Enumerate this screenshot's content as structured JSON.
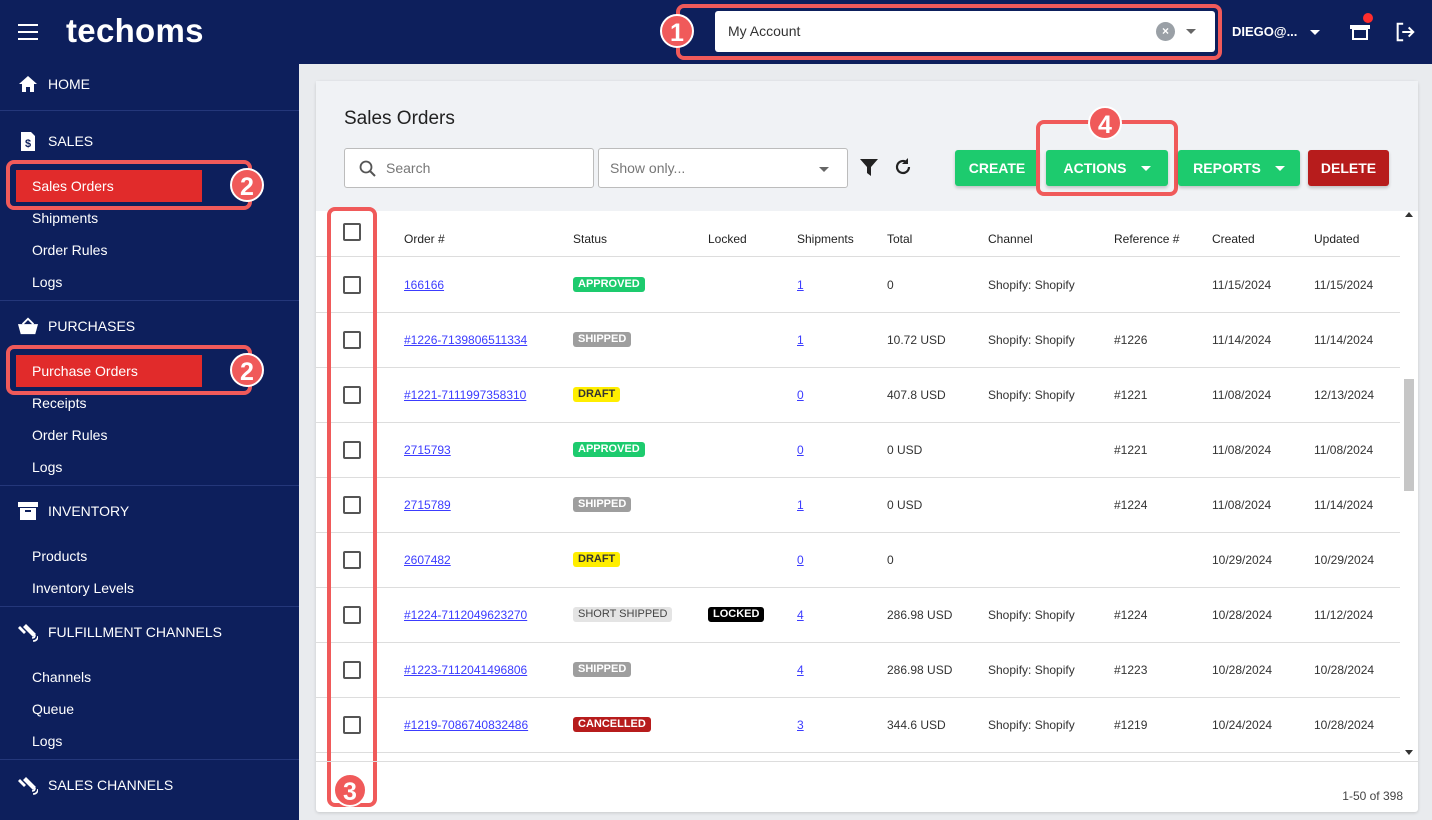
{
  "header": {
    "logo": "techoms",
    "account_value": "My Account",
    "user": "DIEGO@..."
  },
  "callouts": [
    "1",
    "2",
    "2",
    "3",
    "4"
  ],
  "sidebar": {
    "home": "HOME",
    "sales": {
      "title": "SALES",
      "items": [
        "Sales Orders",
        "Shipments",
        "Order Rules",
        "Logs"
      ]
    },
    "purchases": {
      "title": "PURCHASES",
      "items": [
        "Purchase Orders",
        "Receipts",
        "Order Rules",
        "Logs"
      ]
    },
    "inventory": {
      "title": "INVENTORY",
      "items": [
        "Products",
        "Inventory Levels"
      ]
    },
    "fulfillment": {
      "title": "FULFILLMENT CHANNELS",
      "items": [
        "Channels",
        "Queue",
        "Logs"
      ]
    },
    "sales_channels": {
      "title": "SALES CHANNELS"
    }
  },
  "main": {
    "title": "Sales Orders",
    "search_placeholder": "Search",
    "show_only_placeholder": "Show only...",
    "buttons": {
      "create": "CREATE",
      "actions": "ACTIONS",
      "reports": "REPORTS",
      "delete": "DELETE"
    },
    "colors": {
      "green": "#1dcb6e",
      "red": "#b71c1c"
    },
    "columns": [
      "Order #",
      "Status",
      "Locked",
      "Shipments",
      "Total",
      "Channel",
      "Reference #",
      "Created",
      "Updated"
    ],
    "rows": [
      {
        "order": "166166",
        "status": "APPROVED",
        "locked": "",
        "shipments": "1",
        "total": "0",
        "channel": "Shopify: Shopify",
        "reference": "",
        "created": "11/15/2024",
        "updated": "11/15/2024"
      },
      {
        "order": "#1226-7139806511334",
        "status": "SHIPPED",
        "locked": "",
        "shipments": "1",
        "total": "10.72 USD",
        "channel": "Shopify: Shopify",
        "reference": "#1226",
        "created": "11/14/2024",
        "updated": "11/14/2024"
      },
      {
        "order": "#1221-7111997358310",
        "status": "DRAFT",
        "locked": "",
        "shipments": "0",
        "total": "407.8 USD",
        "channel": "Shopify: Shopify",
        "reference": "#1221",
        "created": "11/08/2024",
        "updated": "12/13/2024"
      },
      {
        "order": "2715793",
        "status": "APPROVED",
        "locked": "",
        "shipments": "0",
        "total": "0 USD",
        "channel": "",
        "reference": "#1221",
        "created": "11/08/2024",
        "updated": "11/08/2024"
      },
      {
        "order": "2715789",
        "status": "SHIPPED",
        "locked": "",
        "shipments": "1",
        "total": "0 USD",
        "channel": "",
        "reference": "#1224",
        "created": "11/08/2024",
        "updated": "11/14/2024"
      },
      {
        "order": "2607482",
        "status": "DRAFT",
        "locked": "",
        "shipments": "0",
        "total": "0",
        "channel": "",
        "reference": "",
        "created": "10/29/2024",
        "updated": "10/29/2024"
      },
      {
        "order": "#1224-7112049623270",
        "status": "SHORT SHIPPED",
        "locked": "LOCKED",
        "shipments": "4",
        "total": "286.98 USD",
        "channel": "Shopify: Shopify",
        "reference": "#1224",
        "created": "10/28/2024",
        "updated": "11/12/2024"
      },
      {
        "order": "#1223-7112041496806",
        "status": "SHIPPED",
        "locked": "",
        "shipments": "4",
        "total": "286.98 USD",
        "channel": "Shopify: Shopify",
        "reference": "#1223",
        "created": "10/28/2024",
        "updated": "10/28/2024"
      },
      {
        "order": "#1219-7086740832486",
        "status": "CANCELLED",
        "locked": "",
        "shipments": "3",
        "total": "344.6 USD",
        "channel": "Shopify: Shopify",
        "reference": "#1219",
        "created": "10/24/2024",
        "updated": "10/28/2024"
      }
    ],
    "pagination": "1-50 of 398"
  }
}
